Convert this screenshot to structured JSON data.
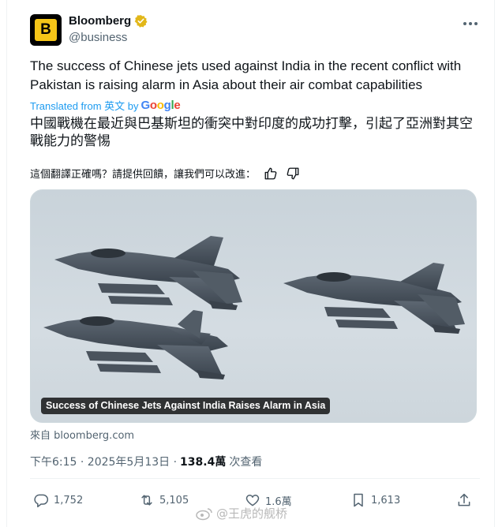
{
  "author": {
    "name": "Bloomberg",
    "handle": "@business",
    "avatar_letter": "B",
    "brand_color": "#f5c518"
  },
  "tweet": {
    "text": "The success of Chinese jets used against India in the recent conflict with Pakistan is raising alarm in Asia about their air combat capabilities",
    "translated_prefix": "Translated from 英文 by",
    "translation": "中國戰機在最近與巴基斯坦的衝突中對印度的成功打擊，引起了亞洲對其空戰能力的警惕",
    "feedback_prompt": "這個翻譯正確嗎？請提供回饋，讓我們可以改進："
  },
  "media": {
    "caption": "Success of Chinese Jets Against India Raises Alarm in Asia",
    "source": "來自 bloomberg.com"
  },
  "meta": {
    "time": "下午6:15 · 2025年5月13日 ·",
    "views": "138.4萬",
    "views_label": "次查看"
  },
  "actions": {
    "replies": "1,752",
    "reposts": "5,105",
    "likes": "1.6萬",
    "bookmarks": "1,613"
  },
  "watermark": {
    "text": "@王虎的舰桥"
  },
  "colors": {
    "accent": "#1d9bf0",
    "secondary_text": "#536471",
    "primary_text": "#0f1419"
  },
  "icons": [
    "verified-badge-icon",
    "more-icon",
    "thumbs-up-icon",
    "thumbs-down-icon",
    "reply-icon",
    "repost-icon",
    "like-icon",
    "bookmark-icon",
    "share-icon"
  ]
}
